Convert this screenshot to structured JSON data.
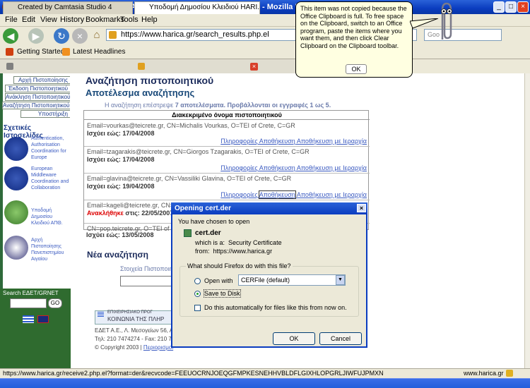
{
  "window": {
    "title": "Υποδομή Δημοσίου Κλειδιού HARICA, Αναζήτηση πιστοποιητικού - Mozilla Firefox",
    "minimize": "_",
    "maximize": "□",
    "close": "×"
  },
  "menu": [
    "File",
    "Edit",
    "View",
    "History",
    "Bookmarks",
    "Tools",
    "Help"
  ],
  "address": {
    "url": "https://www.harica.gr/search_results.php.el",
    "search_placeholder": "Goo"
  },
  "bookmarks": [
    "Getting Started",
    "Latest Headlines"
  ],
  "tabs": [
    {
      "label": "Created by Camtasia Studio 4"
    },
    {
      "label": "Υποδομή Δημοσίου Κλειδιού HARI..."
    }
  ],
  "sidebar": {
    "nav": [
      "Αρχή Πιστοποίησης",
      "Έκδοση Πιστοποιητικού",
      "Ανάκληση Πιστοποιητικού",
      "Αναζήτηση Πιστοποιητικού",
      "Υποστήριξη"
    ],
    "related_title": "Σχετικές Ιστοσελίδες",
    "links": [
      "Authentication, Authorisation Coordination for Europe",
      "European Middleware Coordination and Collaboration",
      "Υποδομή Δημοσίου Κλειδιού ΑΠΘ.",
      "Αρχή Πιστοποίησης Πανεπιστημίου Αιγαίου"
    ],
    "search_label": "Search ΕΔΕΤ/GRNET",
    "go": "GO"
  },
  "main": {
    "title": "Αναζήτηση πιστοποιητικού",
    "subtitle": "Αποτέλεσμα αναζήτησης",
    "note_prefix": "Η αναζήτηση επέστρεψε",
    "note_count": "7 αποτελέσματα. Προβάλλονται οι εγγραφές 1 ως 5.",
    "table_header": "Διακεκριμένο όνομα πιστοποιητικού",
    "actions": [
      "Πληροφορίες",
      "Αποθήκευση",
      "Αποθήκευση με Ιεραρχία"
    ],
    "rows": [
      {
        "dn": "Email=vourkas@teicrete.gr, CN=Michalis Vourkas, O=TEI of Crete, C=GR",
        "until": "Ισχύει εώς: 17/04/2008"
      },
      {
        "dn": "Email=tzagarakis@teicrete.gr, CN=Giorgos Tzagarakis, O=TEI of Crete, C=GR",
        "until": "Ισχύει εώς: 17/04/2008"
      },
      {
        "dn": "Email=glavina@teicrete.gr, CN=Vassiliki Glavina, O=TEI of Crete, C=GR",
        "until": "Ισχύει εώς: 19/04/2008"
      },
      {
        "dn": "Email=kageli@teicrete.gr, CN=Konstantina Kageli, O=TEI of Crete, C=GR",
        "revoked": "Ανακλήθηκε",
        "until": "στις: 22/05/2007"
      },
      {
        "dn": "CN=pop.teicrete.gr, O=TEI of Crete, C=GR",
        "until": "Ισχύει εώς: 13/05/2008"
      }
    ],
    "new_search": "Νέα αναζήτηση",
    "search_field_label": "Στοιχεία Πιστοποιητι",
    "footer": {
      "banner1": "ΕΠΙΧΕΙΡΗΣΙΑΚΟ ΠΡΟΓ",
      "banner2": "ΚΟΙΝΩΝΙΑ ΤΗΣ ΠΛΗΡ",
      "address": "ΕΔΕΤ Α.Ε., Λ. Μεσογείων 56, Α",
      "phone": "Τηλ: 210 7474274 - Fax: 210 7",
      "copyright": "© Copyright 2003 |",
      "terms": "Περιορισμοί"
    }
  },
  "balloon": {
    "text": "This item was not copied because the Office Clipboard is full.  To free space on the Clipboard, switch to an Office program, paste the items where you want them, and then click Clear Clipboard on the Clipboard toolbar.",
    "ok": "OK"
  },
  "dialog": {
    "title": "Opening cert.der",
    "close": "×",
    "chosen": "You have chosen to open",
    "filename": "cert.der",
    "which_is_label": "which is a:",
    "which_is": "Security Certificate",
    "from_label": "from:",
    "from": "https://www.harica.gr",
    "question": "What should Firefox do with this file?",
    "open_with": "Open with",
    "open_with_app": "CERFile (default)",
    "save": "Save to Disk",
    "auto": "Do this automatically for files like this from now on.",
    "ok": "OK",
    "cancel": "Cancel"
  },
  "status": {
    "url": "https://www.harica.gr/receive2.php.el?format=der&recvcode=FEEUOCRNJOEQGFMPKESNEHHVBLDFLGIXHLOPGRLJIWFUJPMXN",
    "site": "www.harica.gr"
  }
}
